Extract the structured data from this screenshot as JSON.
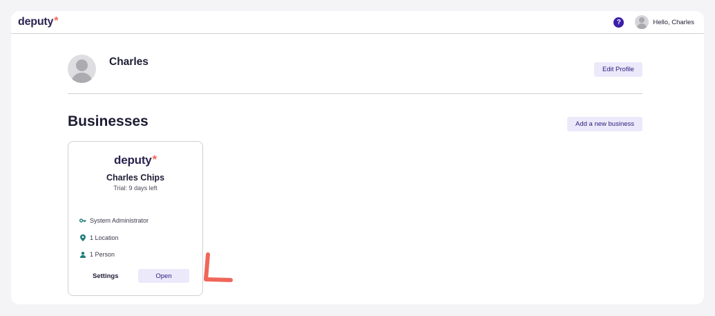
{
  "topbar": {
    "logo_text": "deputy",
    "logo_star": "*",
    "help_label": "?",
    "greeting": "Hello, Charles"
  },
  "profile": {
    "name": "Charles",
    "edit_label": "Edit Profile"
  },
  "businesses": {
    "title": "Businesses",
    "add_label": "Add a new business",
    "cards": [
      {
        "logo_text": "deputy",
        "logo_star": "*",
        "name": "Charles Chips",
        "trial": "Trial: 9 days left",
        "role": "System Administrator",
        "locations": "1 Location",
        "people": "1 Person",
        "settings_label": "Settings",
        "open_label": "Open"
      }
    ]
  },
  "colors": {
    "brand": "#2a2350",
    "accent_star": "#f0665a",
    "button_bg": "#ece9fb",
    "button_text": "#2a1d7a",
    "help_bg": "#3b1fa8",
    "meta_icon": "#1e7d78",
    "annotation": "#f0665a"
  },
  "icons": {
    "help": "question-circle-icon",
    "role": "key-icon",
    "location": "map-pin-icon",
    "person": "person-icon"
  }
}
